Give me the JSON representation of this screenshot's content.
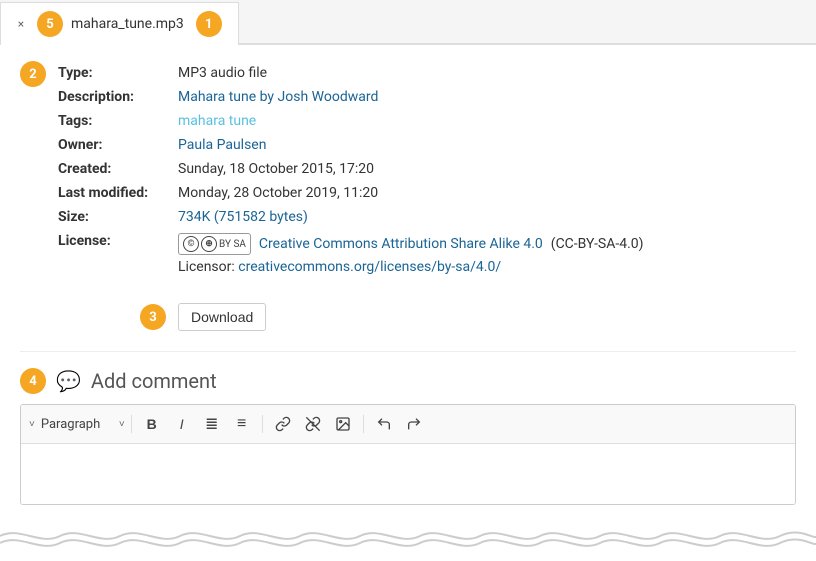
{
  "tab": {
    "badge": "5",
    "close_symbol": "×",
    "filename": "mahara_tune.mp3",
    "filename_badge": "1"
  },
  "file_section_badge": "2",
  "file_info": {
    "type_label": "Type:",
    "type_value": "MP3 audio file",
    "description_label": "Description:",
    "description_value": "Mahara tune by Josh Woodward",
    "tags_label": "Tags:",
    "tags_value": "mahara tune",
    "owner_label": "Owner:",
    "owner_value": "Paula Paulsen",
    "created_label": "Created:",
    "created_value": "Sunday, 18 October 2015, 17:20",
    "modified_label": "Last modified:",
    "modified_value": "Monday, 28 October 2019, 11:20",
    "size_label": "Size:",
    "size_value": "734K (751582 bytes)",
    "license_label": "License:",
    "license_name": "Creative Commons Attribution Share Alike 4.0",
    "license_code": "(CC-BY-SA-4.0)",
    "licensor_label": "Licensor:",
    "licensor_url": "creativecommons.org/licenses/by-sa/4.0/"
  },
  "download_badge": "3",
  "download_button_label": "Download",
  "add_comment": {
    "badge": "4",
    "title": "Add comment",
    "toolbar": {
      "chevron": "˅",
      "paragraph_label": "Paragraph",
      "bold": "B",
      "italic": "I",
      "bullet_list": "≡",
      "ordered_list": "≣",
      "link": "🔗",
      "unlink": "⛓",
      "image": "🖼",
      "undo": "↩",
      "redo": "↪"
    }
  }
}
